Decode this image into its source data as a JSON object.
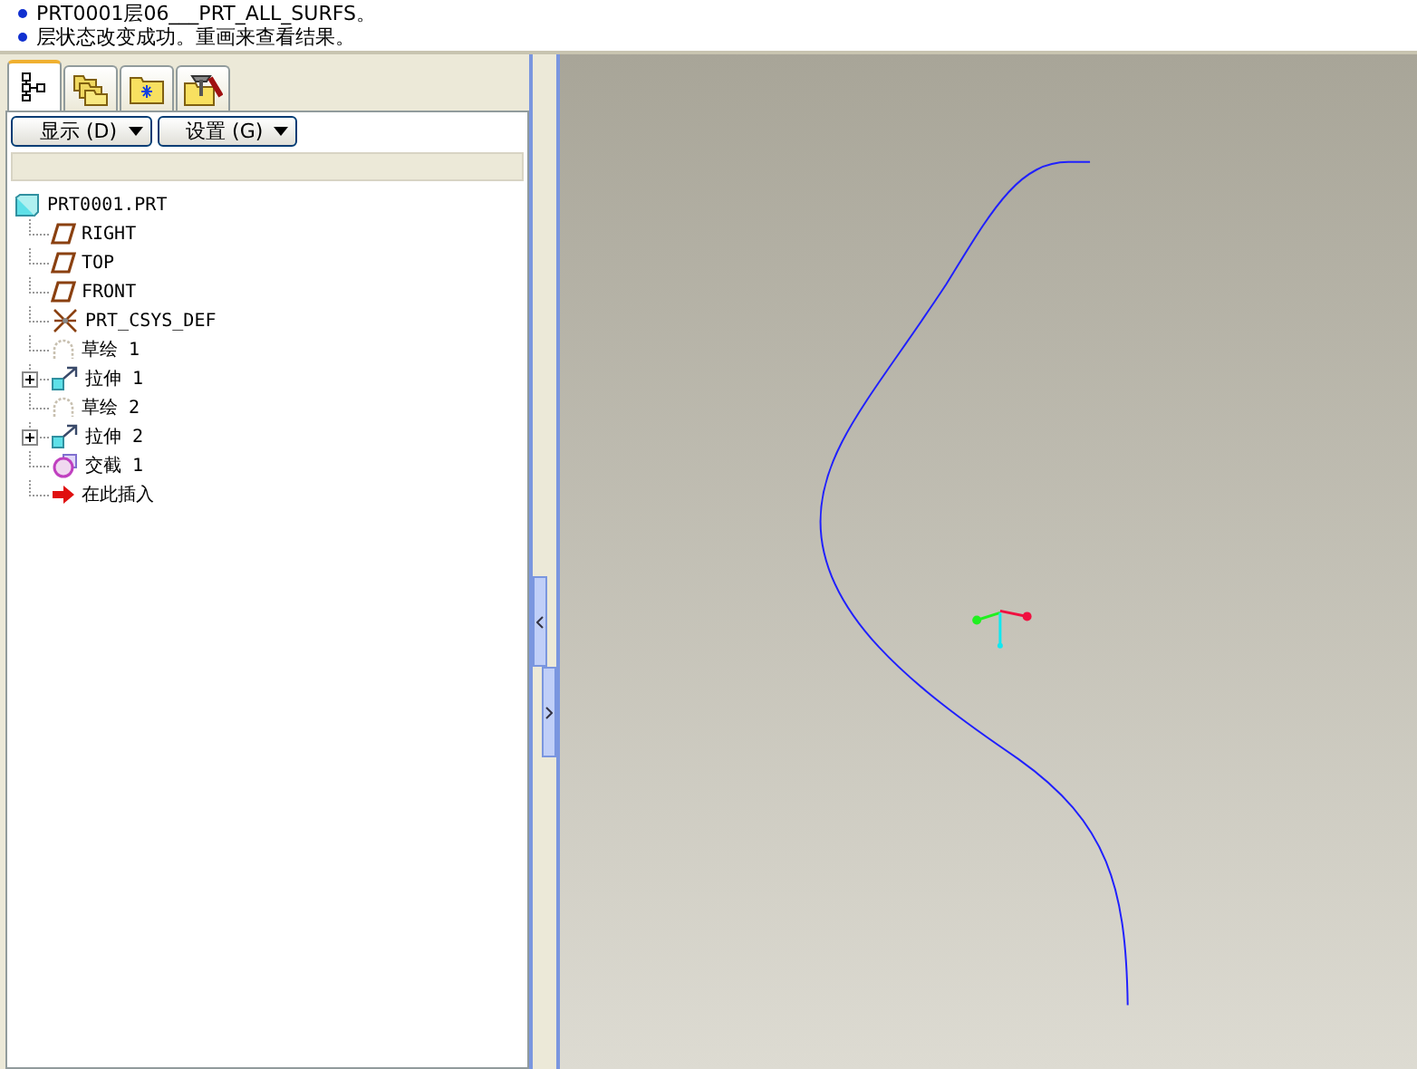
{
  "messages": [
    "PRT0001层06___PRT_ALL_SURFS。",
    "层状态改变成功。重画来查看结果。"
  ],
  "tabs": [
    {
      "kind": "tree",
      "selected": true
    },
    {
      "kind": "folders",
      "selected": false
    },
    {
      "kind": "folder",
      "selected": false
    },
    {
      "kind": "tools",
      "selected": false
    }
  ],
  "buttons": [
    "显示 (D)",
    "设置 (G)"
  ],
  "tree": {
    "label": "PRT0001.PRT",
    "kind": "part",
    "children": [
      {
        "label": "RIGHT",
        "kind": "plane",
        "collapsed": false
      },
      {
        "label": "TOP",
        "kind": "plane",
        "collapsed": false
      },
      {
        "label": "FRONT",
        "kind": "plane",
        "collapsed": false
      },
      {
        "label": "PRT_CSYS_DEF",
        "kind": "csys",
        "collapsed": false
      },
      {
        "label": "草绘 1",
        "kind": "sketch",
        "collapsed": false
      },
      {
        "label": "拉伸 1",
        "kind": "extrude",
        "collapsed": true
      },
      {
        "label": "草绘 2",
        "kind": "sketch",
        "collapsed": false
      },
      {
        "label": "拉伸 2",
        "kind": "extrude",
        "collapsed": true
      },
      {
        "label": "交截 1",
        "kind": "intersect",
        "collapsed": false
      },
      {
        "label": "在此插入",
        "kind": "insert",
        "collapsed": false
      }
    ]
  }
}
